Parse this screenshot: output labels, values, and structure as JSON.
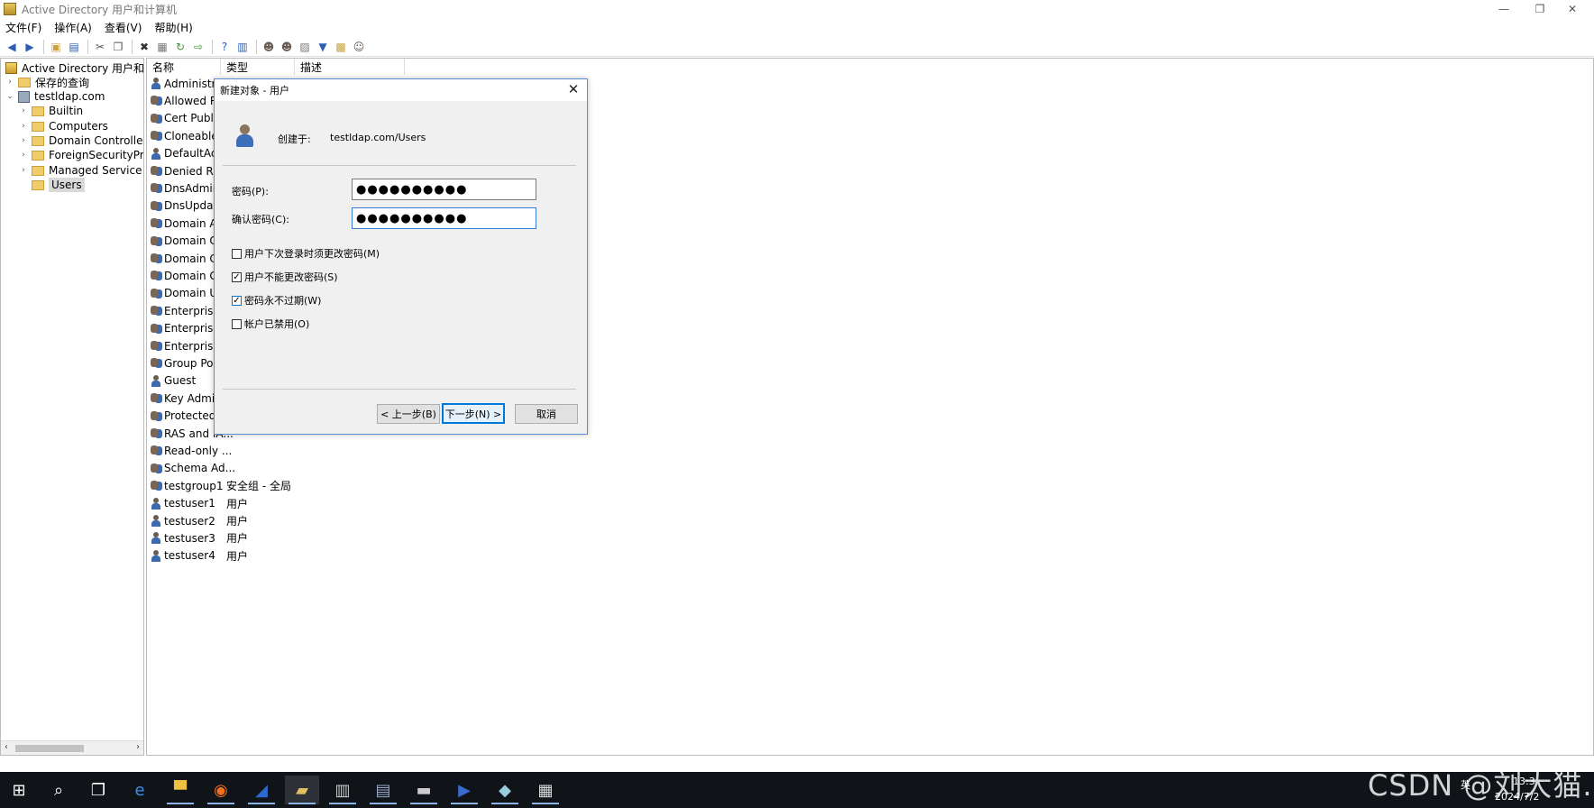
{
  "window": {
    "title": "Active Directory 用户和计算机",
    "minimize_glyph": "—",
    "restore_glyph": "❐",
    "close_glyph": "✕"
  },
  "menu": [
    "文件(F)",
    "操作(A)",
    "查看(V)",
    "帮助(H)"
  ],
  "toolbar_icons": [
    "back-icon",
    "forward-icon",
    "up-folder-icon",
    "show-tree-icon",
    "cut-icon",
    "copy-icon",
    "delete-icon",
    "properties-icon",
    "refresh-icon",
    "export-icon",
    "help-icon",
    "console-icon",
    "new-user-icon",
    "new-group-icon",
    "new-ou-icon",
    "filter-icon",
    "find-icon",
    "add-to-group-icon"
  ],
  "tree": {
    "root": "Active Directory 用户和计算机",
    "saved_queries": "保存的查询",
    "domain": "testldap.com",
    "children": [
      "Builtin",
      "Computers",
      "Domain Controllers",
      "ForeignSecurityPrincipals",
      "Managed Service Accounts",
      "Users"
    ],
    "selected": "Users"
  },
  "list": {
    "headers": [
      "名称",
      "类型",
      "描述"
    ],
    "rows": [
      {
        "name": "Administrat",
        "type": "",
        "kind": "user"
      },
      {
        "name": "Allowed R...",
        "type": "",
        "kind": "group"
      },
      {
        "name": "Cert Publis...",
        "type": "",
        "kind": "group"
      },
      {
        "name": "Cloneable ...",
        "type": "",
        "kind": "group"
      },
      {
        "name": "DefaultAcc...",
        "type": "",
        "kind": "user"
      },
      {
        "name": "Denied RO...",
        "type": "",
        "kind": "group"
      },
      {
        "name": "DnsAdmins",
        "type": "",
        "kind": "group"
      },
      {
        "name": "DnsUpdate...",
        "type": "",
        "kind": "group"
      },
      {
        "name": "Domain Ad...",
        "type": "",
        "kind": "group"
      },
      {
        "name": "Domain Co...",
        "type": "",
        "kind": "group"
      },
      {
        "name": "Domain Co...",
        "type": "",
        "kind": "group"
      },
      {
        "name": "Domain Gu...",
        "type": "",
        "kind": "group"
      },
      {
        "name": "Domain Us...",
        "type": "",
        "kind": "group"
      },
      {
        "name": "Enterprise ...",
        "type": "",
        "kind": "group"
      },
      {
        "name": "Enterprise ...",
        "type": "",
        "kind": "group"
      },
      {
        "name": "Enterprise ...",
        "type": "",
        "kind": "group"
      },
      {
        "name": "Group Poli...",
        "type": "",
        "kind": "group"
      },
      {
        "name": "Guest",
        "type": "",
        "kind": "user"
      },
      {
        "name": "Key Admins",
        "type": "",
        "kind": "group"
      },
      {
        "name": "Protected ...",
        "type": "",
        "kind": "group"
      },
      {
        "name": "RAS and IA...",
        "type": "",
        "kind": "group"
      },
      {
        "name": "Read-only ...",
        "type": "",
        "kind": "group"
      },
      {
        "name": "Schema Ad...",
        "type": "",
        "kind": "group"
      },
      {
        "name": "testgroup1",
        "type": "安全组 - 全局",
        "kind": "group"
      },
      {
        "name": "testuser1",
        "type": "用户",
        "kind": "user"
      },
      {
        "name": "testuser2",
        "type": "用户",
        "kind": "user"
      },
      {
        "name": "testuser3",
        "type": "用户",
        "kind": "user"
      },
      {
        "name": "testuser4",
        "type": "用户",
        "kind": "user"
      }
    ]
  },
  "dialog": {
    "title": "新建对象 - 用户",
    "close_glyph": "✕",
    "created_in_label": "创建于:",
    "created_in_value": "testldap.com/Users",
    "password_label": "密码(P):",
    "password_value": "●●●●●●●●●●",
    "confirm_label": "确认密码(C):",
    "confirm_value": "●●●●●●●●●●",
    "checkboxes": [
      {
        "label": "用户下次登录时须更改密码(M)",
        "checked": false
      },
      {
        "label": "用户不能更改密码(S)",
        "checked": true
      },
      {
        "label": "密码永不过期(W)",
        "checked": true
      },
      {
        "label": "帐户已禁用(O)",
        "checked": false
      }
    ],
    "back_button": "< 上一步(B)",
    "next_button": "下一步(N) >",
    "cancel_button": "取消"
  },
  "taskbar": {
    "apps": [
      "windows-start-icon",
      "search-icon",
      "task-view-icon",
      "ie-icon",
      "explorer-icon",
      "firefox-icon",
      "powershell-ise-icon",
      "ad-users-icon",
      "server-manager-icon",
      "file-icon",
      "cmd-icon",
      "powershell-icon",
      "notepad-icon",
      "gallery-icon"
    ],
    "clock_time": "13:3",
    "clock_date": "2024/7/2",
    "ime": "英"
  },
  "watermark": "CSDN @刘大猫."
}
